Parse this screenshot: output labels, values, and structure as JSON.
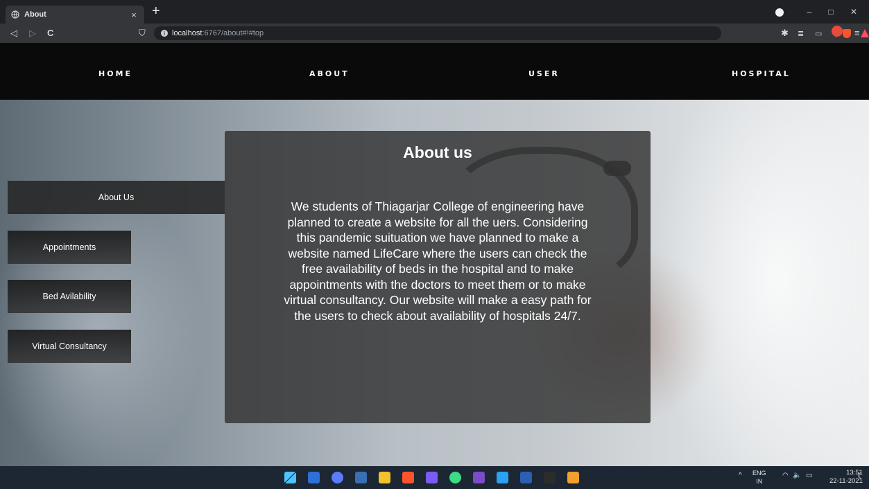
{
  "browser": {
    "tab_title": "About",
    "tab_close": "×",
    "new_tab": "+",
    "url_host": "localhost",
    "url_path": ":6767/about#!#top",
    "nav_back": "◁",
    "nav_forward": "▷",
    "nav_reload": "C",
    "bookmark": "⛉",
    "window_min": "–",
    "window_max": "□",
    "window_close": "✕",
    "ext_puzzle": "✱",
    "ext_menu": "≡"
  },
  "navbar": {
    "links": [
      "HOME",
      "ABOUT",
      "USER",
      "HOSPITAL"
    ]
  },
  "sidebar": {
    "items": [
      "About Us",
      "Appointments",
      "Bed Avilability",
      "Virtual Consultancy"
    ]
  },
  "about": {
    "title": "About us",
    "body": "We students of Thiagarjar College of engineering have planned to create a website for all the uers. Considering this pandemic suituation we have planned to make a website named LifeCare where the users can check the free availability of beds in the hospital and to make appointments with the doctors to meet them or to make virtual consultancy. Our website will make a easy path for the users to check about availability of hospitals 24/7."
  },
  "taskbar": {
    "lang_top": "ENG",
    "lang_bottom": "IN",
    "time": "13:51",
    "date": "22-11-2021",
    "tray_chevron": "^",
    "tray_wifi": "◠",
    "tray_volume": "🔈",
    "tray_battery": "▭",
    "notification": "☾",
    "icon_colors": [
      "#3c8ee8",
      "#2f6fd8",
      "#5a7dfa",
      "#3a6fb5",
      "#f2c12e",
      "#fb542b",
      "#7a5cf4",
      "#3ddc84",
      "#7a4cc8",
      "#2aa1f2",
      "#2b5fb3",
      "#2c2c2c",
      "#f2a02e"
    ]
  }
}
